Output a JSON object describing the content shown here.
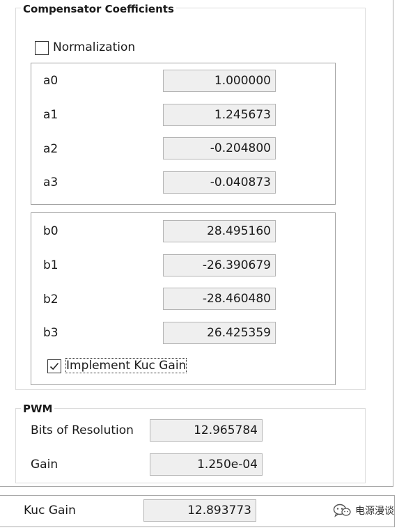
{
  "compensator": {
    "title": "Compensator Coefficients",
    "normalization": {
      "label": "Normalization",
      "checked": false
    },
    "a_coefficients": [
      {
        "label": "a0",
        "value": "1.000000"
      },
      {
        "label": "a1",
        "value": "1.245673"
      },
      {
        "label": "a2",
        "value": "-0.204800"
      },
      {
        "label": "a3",
        "value": "-0.040873"
      }
    ],
    "b_coefficients": [
      {
        "label": "b0",
        "value": "28.495160"
      },
      {
        "label": "b1",
        "value": "-26.390679"
      },
      {
        "label": "b2",
        "value": "-28.460480"
      },
      {
        "label": "b3",
        "value": "26.425359"
      }
    ],
    "implement_kuc_gain": {
      "label": "Implement Kuc Gain",
      "checked": true
    }
  },
  "pwm": {
    "title": "PWM",
    "bits_of_resolution": {
      "label": "Bits of Resolution",
      "value": "12.965784"
    },
    "gain": {
      "label": "Gain",
      "value": "1.250e-04"
    }
  },
  "kuc_gain": {
    "label": "Kuc Gain",
    "value": "12.893773"
  },
  "watermark": {
    "text": "电源漫谈",
    "icon": "wechat-icon"
  }
}
